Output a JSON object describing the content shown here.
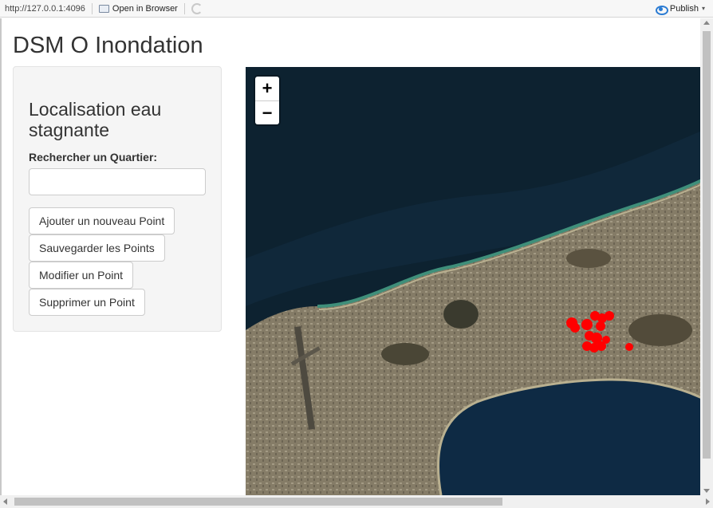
{
  "toolbar": {
    "url": "http://127.0.0.1:4096",
    "open_in_browser": "Open in Browser",
    "publish": "Publish",
    "publish_caret": "▾"
  },
  "page": {
    "title": "DSM O Inondation"
  },
  "sidebar": {
    "heading": "Localisation eau stagnante",
    "search_label": "Rechercher un Quartier:",
    "search_value": "",
    "buttons": [
      "Ajouter un nouveau Point",
      "Sauvegarder les Points",
      "Modifier un Point",
      "Supprimer un Point"
    ]
  },
  "map": {
    "zoom_in": "+",
    "zoom_out": "−",
    "marker_color": "#ff0000",
    "water_color": "#0d2230",
    "land_color": "#7d7561"
  }
}
